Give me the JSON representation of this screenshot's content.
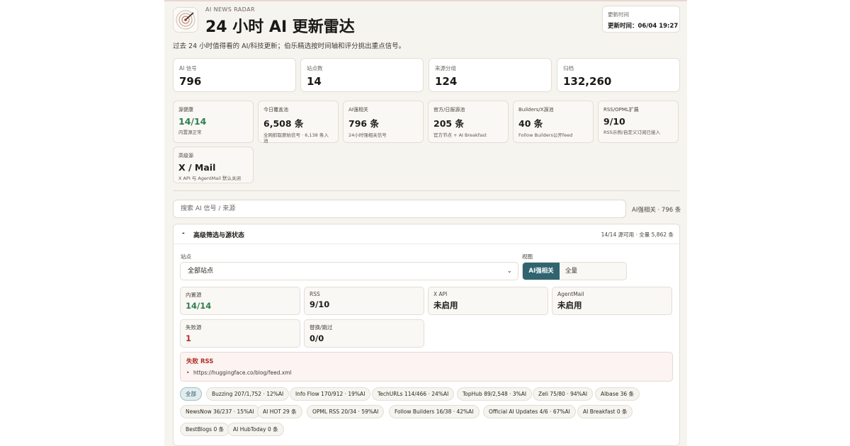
{
  "header": {
    "brand": "AI NEWS RADAR",
    "title": "24 小时 AI 更新雷达",
    "update_label": "更新时间",
    "update_value": "更新时间：06/04 19:27",
    "subtitle": "过去 24 小时值得看的 AI/科技更新；伯乐精选按时间轴和评分挑出重点信号。"
  },
  "stats": [
    {
      "label": "AI 信号",
      "value": "796"
    },
    {
      "label": "站点数",
      "value": "14"
    },
    {
      "label": "来源分组",
      "value": "124"
    },
    {
      "label": "归档",
      "value": "132,260"
    }
  ],
  "minis": [
    {
      "label": "源健康",
      "value": "14/14",
      "note": "内置源正常"
    },
    {
      "label": "今日覆盖池",
      "value": "6,508 条",
      "note": "全网抓取原始信号 · 6,138 条入池"
    },
    {
      "label": "AI强相关",
      "value": "796 条",
      "note": "24小时强相关信号"
    },
    {
      "label": "官方/日报源池",
      "value": "205 条",
      "note": "官方节点 + AI Breakfast"
    },
    {
      "label": "Builders/X源池",
      "value": "40 条",
      "note": "Follow Builders公开feed"
    },
    {
      "label": "RSS/OPML扩展",
      "value": "9/10",
      "note": "RSS示例/自定义订阅已接入"
    },
    {
      "label": "高级源",
      "value": "X / Mail",
      "note": "X API 与 AgentMail 默认关闭"
    }
  ],
  "search": {
    "placeholder": "搜索 AI 信号 / 来源",
    "count": "AI强相关 · 796 条"
  },
  "panel": {
    "toggle": "-",
    "title": "高级筛选与源状态",
    "summary": "14/14 源可用 · 全量 5,862 条",
    "site_label": "站点",
    "site_value": "全部站点",
    "view_label": "视图",
    "view_on": "AI强相关",
    "view_off": "全量",
    "status": [
      {
        "label": "内置源",
        "value": "14/14"
      },
      {
        "label": "RSS",
        "value": "9/10"
      },
      {
        "label": "X API",
        "value": "未启用"
      },
      {
        "label": "AgentMail",
        "value": "未启用"
      },
      {
        "label": "失败源",
        "value": "1"
      },
      {
        "label": "替换/跳过",
        "value": "0/0"
      }
    ],
    "fail_title": "失败 RSS",
    "fail_item": "https://huggingface.co/blog/feed.xml"
  },
  "chips": [
    "全部",
    "Buzzing 207/1,752 · 12%AI",
    "Info Flow 170/912 · 19%AI",
    "TechURLs 114/466 · 24%AI",
    "TopHub 89/2,548 · 3%AI",
    "Zeli 75/80 · 94%AI",
    "AIbase 36 条",
    "NewsNow 36/237 · 15%AI",
    "AI HOT 29 条",
    "OPML RSS 20/34 · 59%AI",
    "Follow Builders 16/38 · 42%AI",
    "Official AI Updates 4/6 · 67%AI",
    "AI Breakfast 0 条",
    "BestBlogs 0 条",
    "AI HubToday 0 条"
  ],
  "colors": {
    "accent": "#2f6470",
    "healthy": "#2e7d4f",
    "error": "#b42e22",
    "page_bg": "#f6f4ef"
  },
  "icons": {
    "logo": "radar-logo-icon",
    "select": "chevron-down-icon"
  }
}
